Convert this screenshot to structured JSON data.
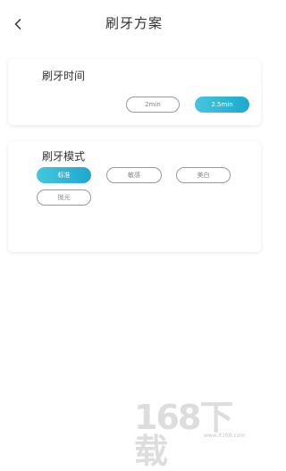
{
  "header": {
    "title": "刷牙方案",
    "back_icon": "chevron-left-icon"
  },
  "brush_time": {
    "title": "刷牙时间",
    "options": [
      "2min",
      "2.5min"
    ],
    "selected_index": 1
  },
  "brush_mode": {
    "title": "刷牙模式",
    "options": [
      "标准",
      "敏感",
      "美白",
      "抛光"
    ],
    "selected_index": 0
  },
  "colors": {
    "accent_start": "#44c6de",
    "accent_end": "#1ea8cf"
  },
  "watermark": {
    "text": "168下载",
    "url": "www.it168.com"
  }
}
